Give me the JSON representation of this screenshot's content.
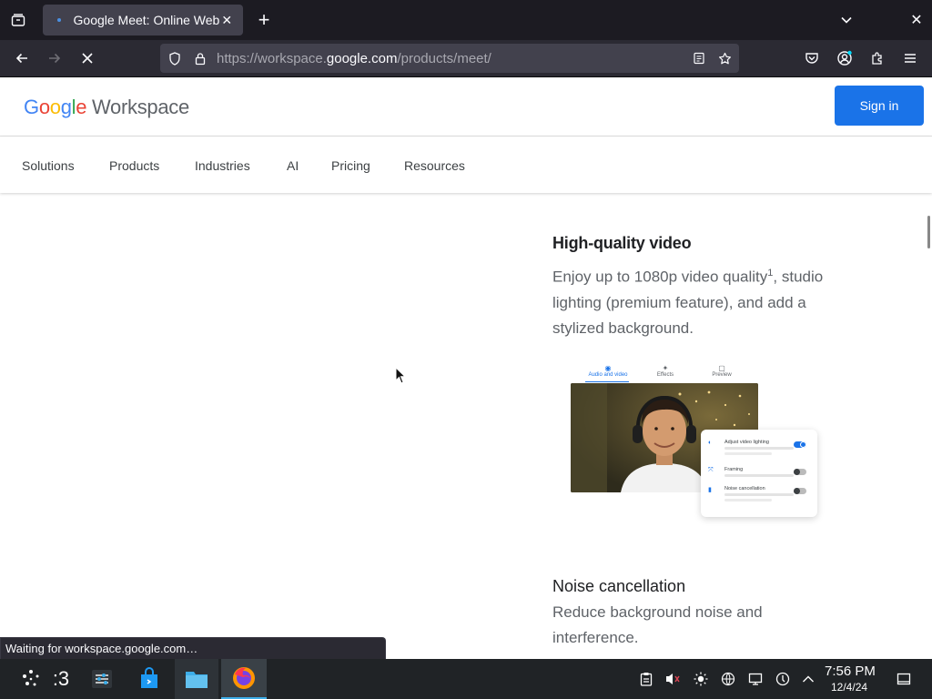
{
  "browser": {
    "tab_title": "Google Meet: Online Web and Video Conferencing Calls",
    "url_prefix": "https://workspace.",
    "url_domain": "google.com",
    "url_path": "/products/meet/",
    "status": "Waiting for workspace.google.com…"
  },
  "site": {
    "logo_google_g": "G",
    "logo_google_o1": "o",
    "logo_google_o2": "o",
    "logo_google_g2": "g",
    "logo_google_l": "l",
    "logo_google_e": "e",
    "logo_workspace": " Workspace",
    "signin": "Sign in",
    "nav": [
      "Solutions",
      "Products",
      "Industries",
      "AI",
      "Pricing",
      "Resources"
    ]
  },
  "content": {
    "hq_title": "High-quality video",
    "hq_text_a": "Enjoy up to 1080p video quality",
    "hq_sup": "1",
    "hq_text_b": ", studio lighting (premium feature), and add a stylized background.",
    "noise_title": "Noise cancellation",
    "noise_text": "Reduce background noise and interference."
  },
  "illustration": {
    "tabs": [
      "Audio and video",
      "Effects",
      "Preview"
    ],
    "rows": [
      {
        "label": "Adjust video lighting",
        "on": true
      },
      {
        "label": "Framing",
        "on": false
      },
      {
        "label": "Noise cancellation",
        "on": false
      }
    ]
  },
  "taskbar": {
    "desktop_label": ":3",
    "time": "7:56 PM",
    "date": "12/4/24"
  },
  "colors": {
    "accent": "#1a73e8",
    "chrome_bg": "#1c1b22",
    "toolbar_bg": "#2b2a33",
    "taskbar_bg": "#202326"
  }
}
